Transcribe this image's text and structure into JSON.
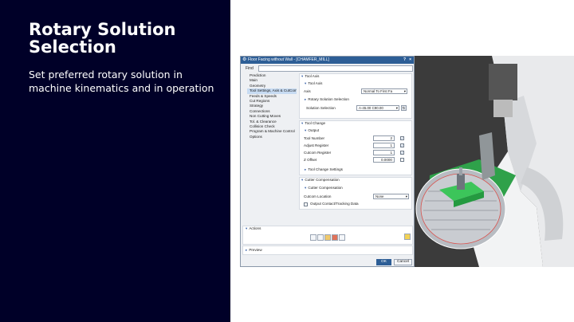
{
  "slide": {
    "title": "Rotary Solution Selection",
    "subtitle": "Set preferred rotary solution in machine kinematics and in operation"
  },
  "dialog": {
    "title": "Floor Facing without Wall - [CHAMFER_MILL]",
    "help_label": "?",
    "close_label": "×",
    "find_label": "Find",
    "find_value": "",
    "nav": [
      {
        "label": "Prediction"
      },
      {
        "label": "Main"
      },
      {
        "label": "Geometry"
      },
      {
        "label": "Tool Settings, Axis & CutCom"
      },
      {
        "label": "Feeds & Speeds"
      },
      {
        "label": "Cut Regions"
      },
      {
        "label": "Strategy"
      },
      {
        "label": "Connections"
      },
      {
        "label": "Non Cutting Moves"
      },
      {
        "label": "Tol. & Clearance"
      },
      {
        "label": "Collision Check"
      },
      {
        "label": "Program & Machine Control"
      },
      {
        "label": "Options"
      }
    ],
    "tool_axis": {
      "header": "Tool Axis",
      "sub_header": "Tool Axis",
      "axis_label": "Axis",
      "axis_value": "Normal To First Fa",
      "rotary_header": "Rotary Solution Selection",
      "solution_label": "Solution Selection",
      "solution_value": "A-45.00 C90.00"
    },
    "tool_change": {
      "header": "Tool Change",
      "output_header": "Output",
      "tool_number_label": "Tool Number",
      "tool_number_value": "2",
      "adjust_label": "Adjust Register",
      "adjust_value": "1",
      "cutcom_label": "Cutcom Register",
      "cutcom_value": "1",
      "zoffset_label": "Z Offset",
      "zoffset_value": "0.0000",
      "settings_header": "Tool Change Settings"
    },
    "cutter_comp": {
      "header": "Cutter Compensation",
      "sub_header": "Cutter Compensation",
      "location_label": "Cutcom Location",
      "location_value": "None",
      "output_contact_label": "Output Contact/Tracking Data"
    },
    "actions_header": "Actions",
    "preview_header": "Preview",
    "ok_label": "OK",
    "cancel_label": "Cancel"
  }
}
